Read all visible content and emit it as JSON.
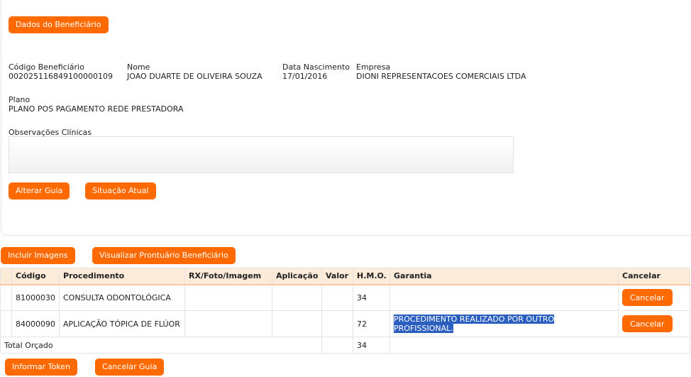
{
  "header": {
    "title_button": "Dados do Beneficiário"
  },
  "beneficiary": {
    "codigo_label": "Código Beneficiário",
    "codigo_value": "002025116849100000109",
    "nome_label": "Nome",
    "nome_value": "JOAO DUARTE DE OLIVEIRA SOUZA",
    "nasc_label": "Data Nascimento",
    "nasc_value": "17/01/2016",
    "empresa_label": "Empresa",
    "empresa_value": "DIONI REPRESENTACOES COMERCIAIS LTDA",
    "plano_label": "Plano",
    "plano_value": "PLANO POS PAGAMENTO REDE PRESTADORA",
    "obs_label": "Observações Clínicas",
    "obs_value": ""
  },
  "actions": {
    "alterar_guia": "Alterar Guia",
    "situacao_atual": "Situação Atual",
    "incluir_imagens": "Incluir Imagens",
    "visualizar_prontuario": "Visualizar Prontuário Beneficiário",
    "informar_token": "Informar Token",
    "cancelar_guia": "Cancelar Guia"
  },
  "table": {
    "headers": [
      "",
      "Código",
      "Procedimento",
      "RX/Foto/Imagem",
      "Aplicação",
      "Valor",
      "H.M.O.",
      "Garantia",
      "Cancelar"
    ],
    "rows": [
      {
        "codigo": "81000030",
        "procedimento": "CONSULTA ODONTOLÓGICA",
        "rx": "",
        "aplicacao": "",
        "valor": "",
        "hmo": "34",
        "garantia": "",
        "cancel_label": "Cancelar"
      },
      {
        "codigo": "84000090",
        "procedimento": "APLICAÇÃO TÓPICA DE FLÚOR",
        "rx": "",
        "aplicacao": "",
        "valor": "",
        "hmo": "72",
        "garantia": "PROCEDIMENTO REALIZADO POR OUTRO PROFISSIONAL.",
        "cancel_label": "Cancelar"
      }
    ],
    "total_label": "Total Orçado",
    "total_hmo": "34"
  },
  "colors": {
    "accent": "#ff6a00",
    "header_bg": "#fdebd9",
    "highlight": "#2b5fbf"
  }
}
